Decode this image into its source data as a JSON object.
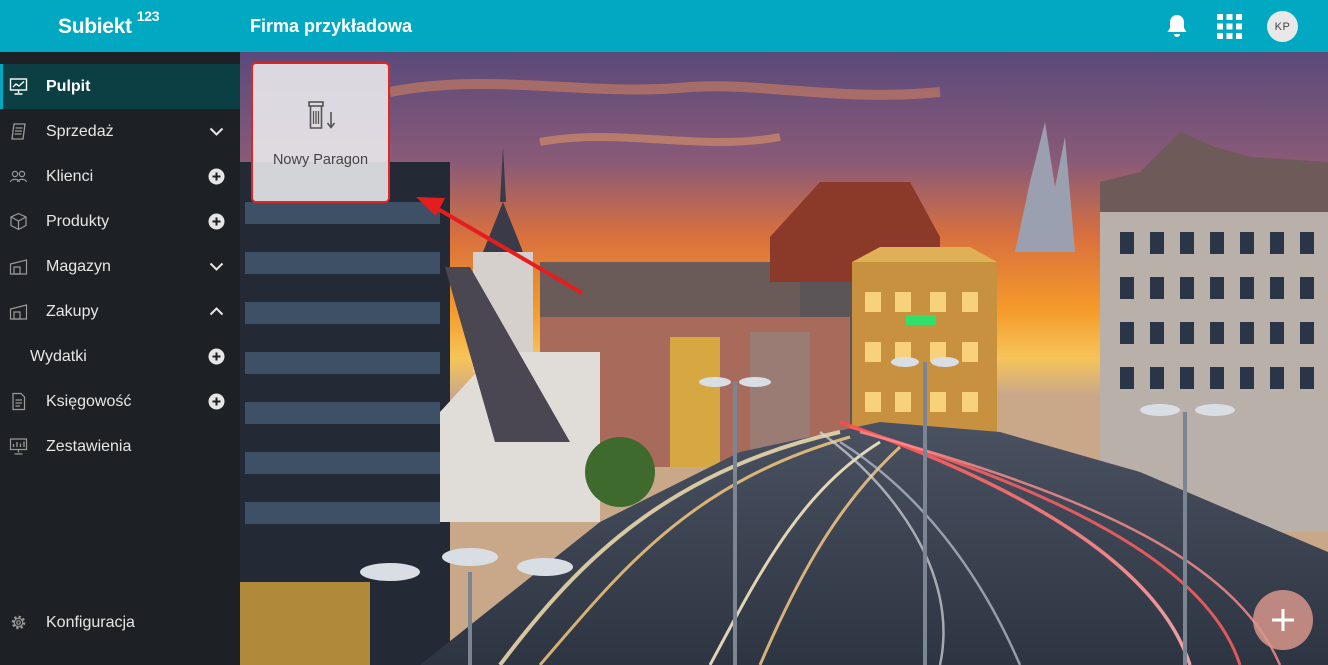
{
  "header": {
    "logo_text": "Subiekt",
    "logo_suffix": "123",
    "company_name": "Firma przykładowa",
    "bell_icon": "bell-icon",
    "apps_icon": "grid-apps-icon",
    "avatar_initials": "KP",
    "accent_color": "#00a8c2"
  },
  "sidebar": {
    "items": [
      {
        "label": "Pulpit",
        "icon": "dashboard-icon",
        "right": "none",
        "active": true
      },
      {
        "label": "Sprzedaż",
        "icon": "sales-document-icon",
        "right": "chevron-down-icon"
      },
      {
        "label": "Klienci",
        "icon": "people-icon",
        "right": "plus-circle-icon"
      },
      {
        "label": "Produkty",
        "icon": "box-icon",
        "right": "plus-circle-icon"
      },
      {
        "label": "Magazyn",
        "icon": "warehouse-icon",
        "right": "chevron-down-icon"
      },
      {
        "label": "Zakupy",
        "icon": "purchase-icon",
        "right": "chevron-up-icon"
      },
      {
        "label": "Wydatki",
        "icon": "none",
        "right": "plus-circle-icon"
      },
      {
        "label": "Księgowość",
        "icon": "accounting-document-icon",
        "right": "plus-circle-icon"
      },
      {
        "label": "Zestawienia",
        "icon": "report-chart-icon",
        "right": "none"
      }
    ],
    "settings_label": "Konfiguracja",
    "settings_icon": "gear-icon",
    "active_color": "#0b3f44"
  },
  "dashboard": {
    "tile_label": "Nowy Paragon",
    "tile_icon": "receipt-icon",
    "highlight_color": "#e12424",
    "fab_icon": "plus-icon"
  }
}
